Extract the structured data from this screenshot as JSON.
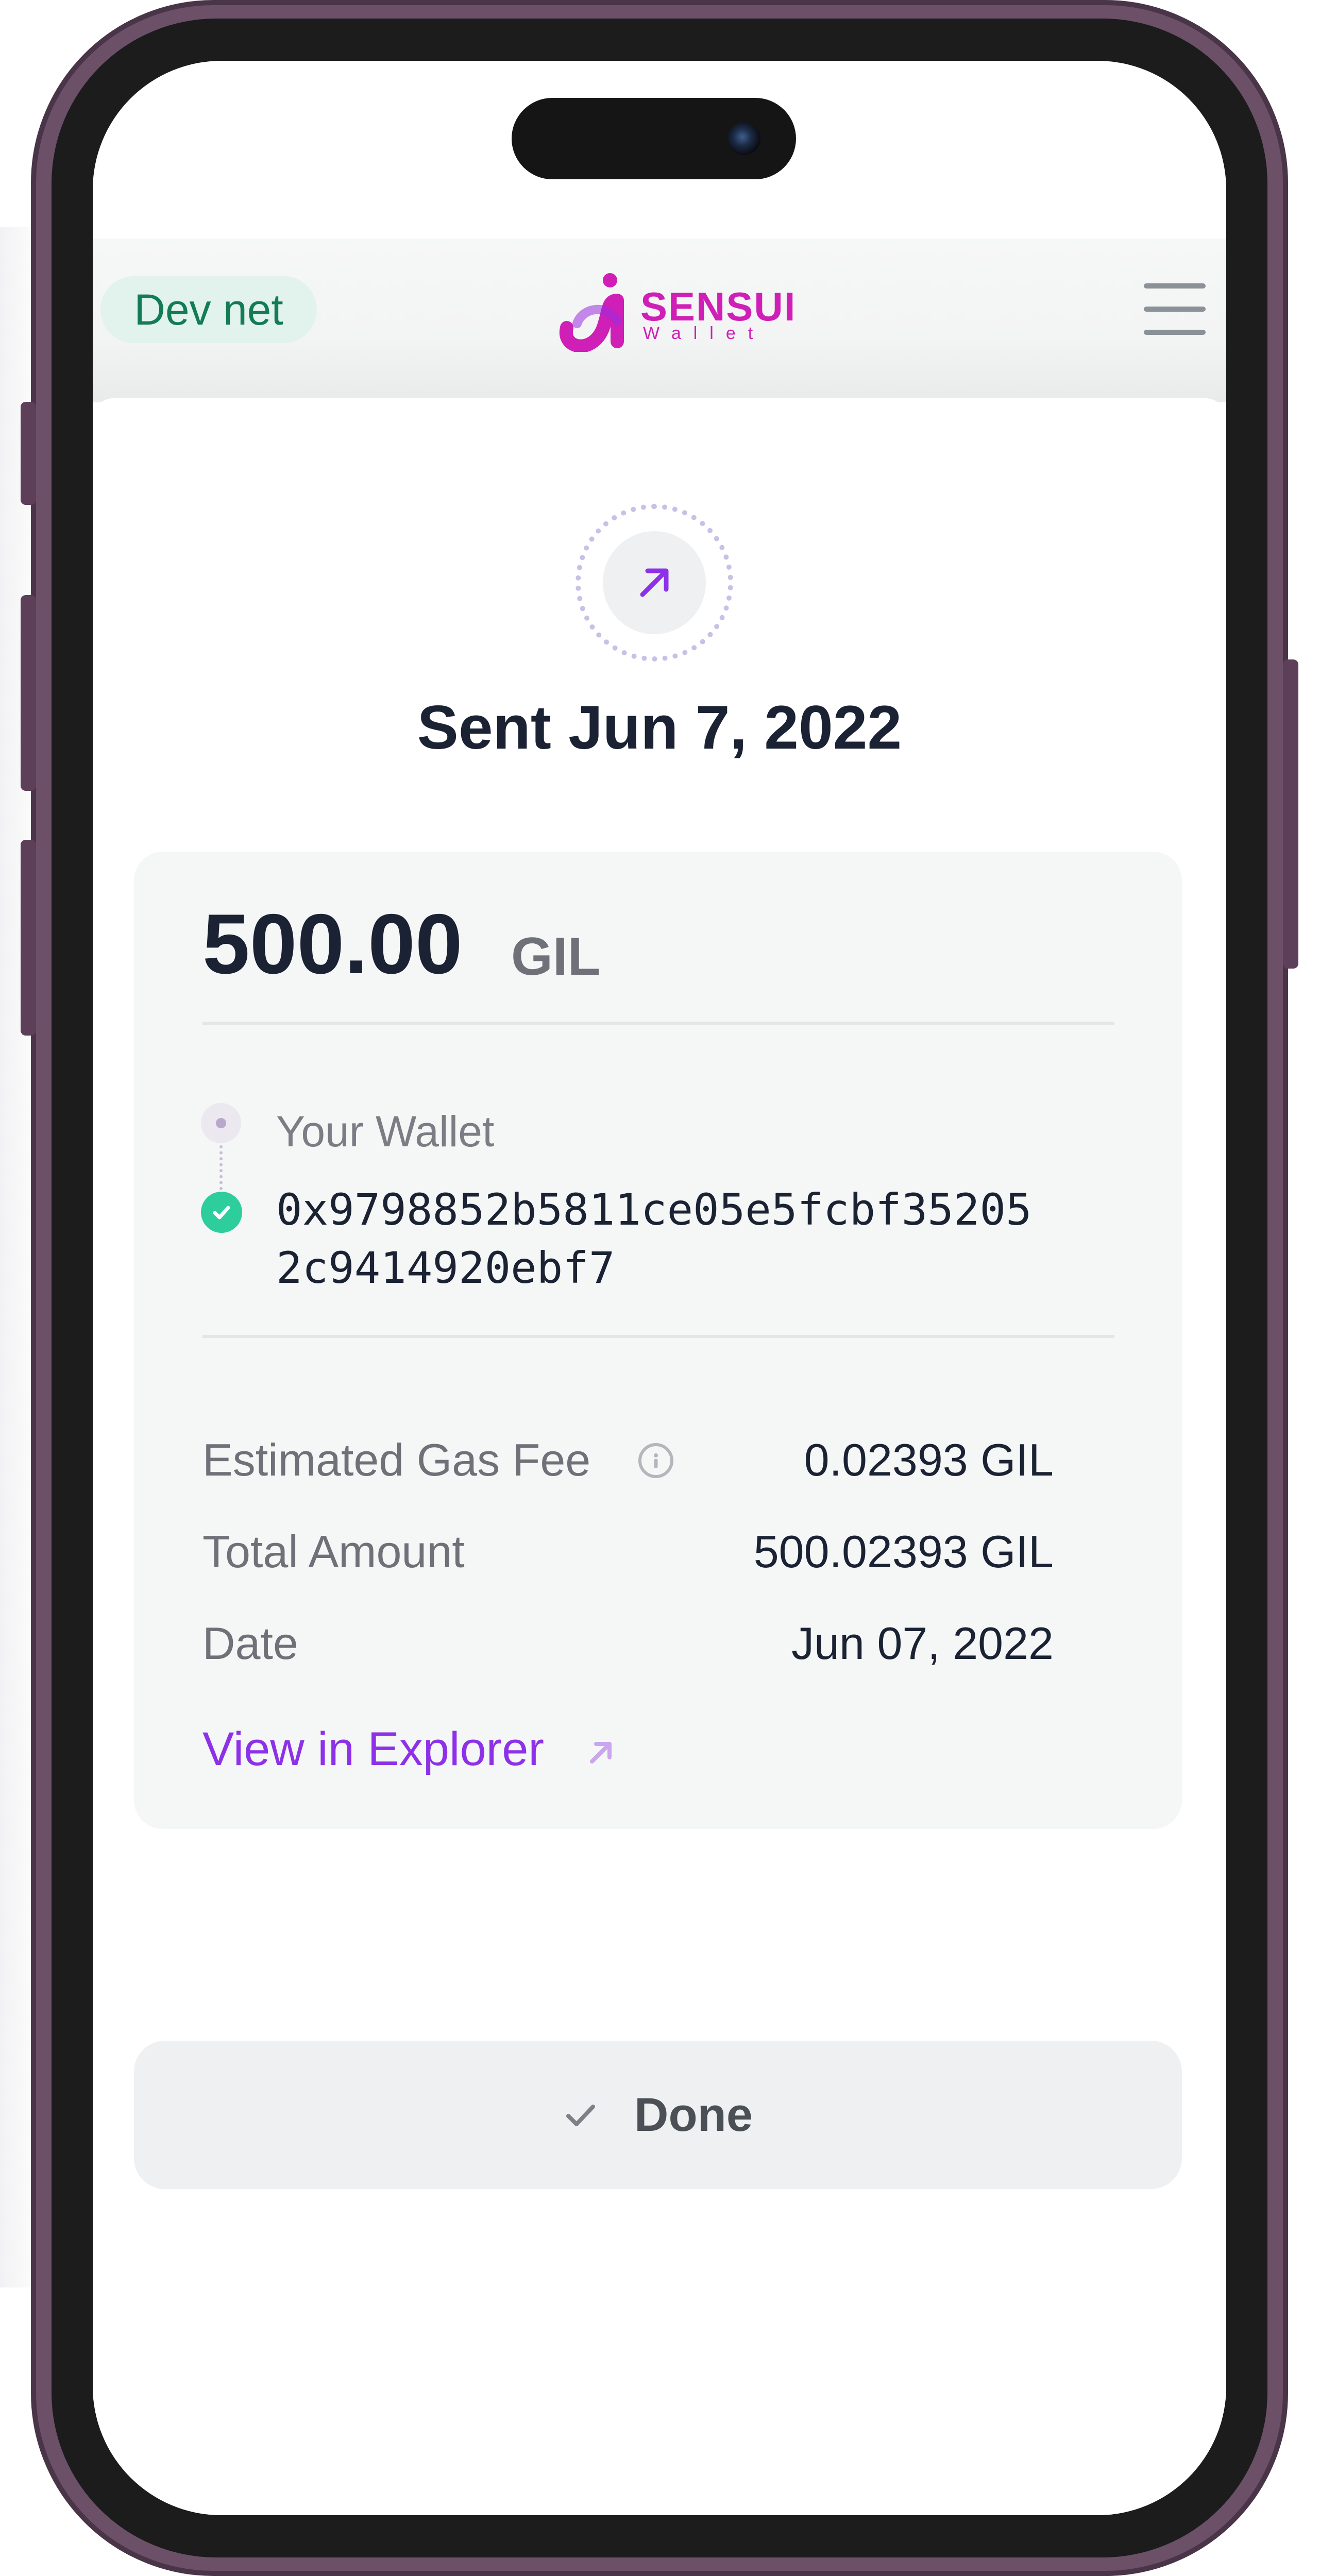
{
  "header": {
    "network_label": "Dev net",
    "logo_text": "SENSUI",
    "logo_subtext": "Wallet",
    "menu_icon": "hamburger-menu-icon"
  },
  "transaction": {
    "status_icon": "arrow-up-right-icon",
    "title": "Sent Jun 7, 2022",
    "amount": "500.00",
    "currency": "GIL",
    "from_label": "Your Wallet",
    "to_address_line1": "0x9798852b5811ce05e5fcbf35205",
    "to_address_line2": "2c9414920ebf7",
    "details": [
      {
        "label": "Estimated Gas Fee",
        "value": "0.02393 GIL"
      },
      {
        "label": "Total Amount",
        "value": "500.02393 GIL"
      },
      {
        "label": "Date",
        "value": "Jun 07, 2022"
      }
    ],
    "explorer_link": "View in Explorer"
  },
  "actions": {
    "done_label": "Done"
  },
  "colors": {
    "accent": "#8d31e8",
    "brand": "#cf1fb6",
    "success": "#2dcd9c",
    "network_text": "#137c56"
  }
}
